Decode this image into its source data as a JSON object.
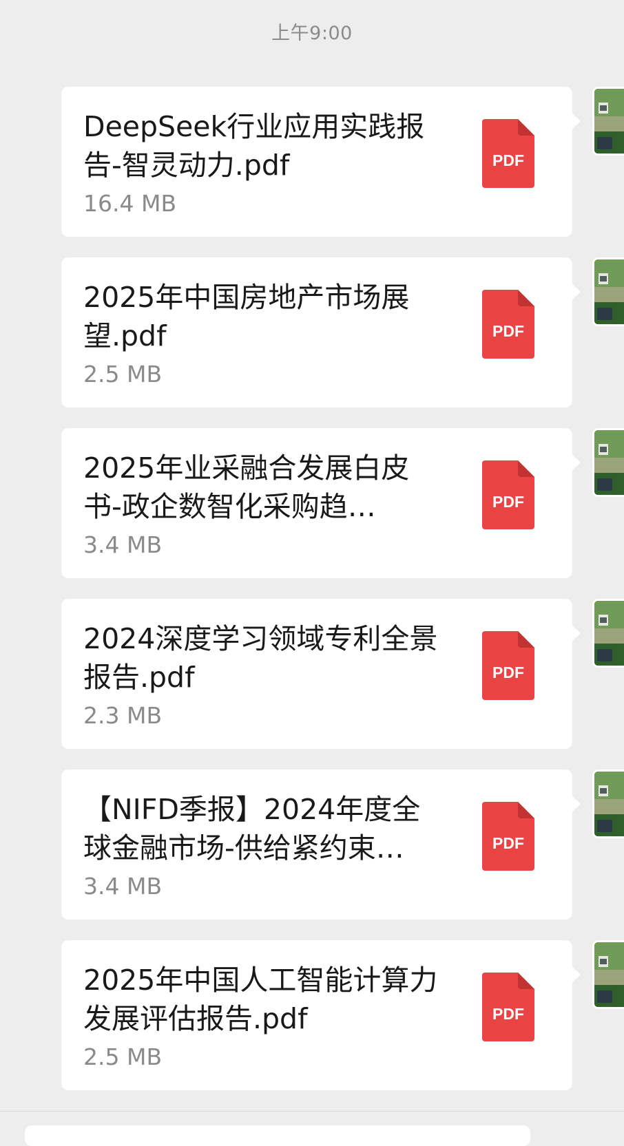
{
  "chat": {
    "timestamp": "上午9:00",
    "messages": [
      {
        "file_name": "DeepSeek行业应用实践报告-智灵动力.pdf",
        "file_size": "16.4 MB",
        "icon": "pdf-file-icon",
        "icon_label": "PDF"
      },
      {
        "file_name": "2025年中国房地产市场展望.pdf",
        "file_size": "2.5 MB",
        "icon": "pdf-file-icon",
        "icon_label": "PDF"
      },
      {
        "file_name": "2025年业采融合发展白皮书-政企数智化采购趋…",
        "file_size": "3.4 MB",
        "icon": "pdf-file-icon",
        "icon_label": "PDF"
      },
      {
        "file_name": "2024深度学习领域专利全景报告.pdf",
        "file_size": "2.3 MB",
        "icon": "pdf-file-icon",
        "icon_label": "PDF"
      },
      {
        "file_name": "【NIFD季报】2024年度全球金融市场-供给紧约束…",
        "file_size": "3.4 MB",
        "icon": "pdf-file-icon",
        "icon_label": "PDF"
      },
      {
        "file_name": "2025年中国人工智能计算力发展评估报告.pdf",
        "file_size": "2.5 MB",
        "icon": "pdf-file-icon",
        "icon_label": "PDF"
      }
    ]
  },
  "colors": {
    "background": "#ededed",
    "bubble": "#ffffff",
    "pdf_red": "#e94343",
    "pdf_fold": "#c13232",
    "text_primary": "#191919",
    "text_secondary": "#8a8a8a"
  }
}
